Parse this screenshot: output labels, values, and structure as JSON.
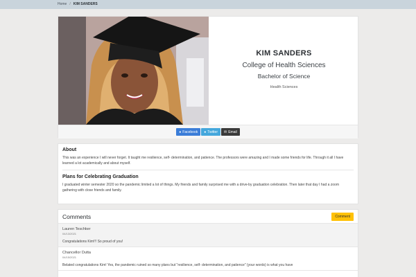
{
  "breadcrumb": {
    "home": "Home",
    "separator": "/",
    "current": "KIM SANDERS"
  },
  "profile": {
    "name": "KIM SANDERS",
    "college": "College of Health Sciences",
    "degree": "Bachelor of Science",
    "major": "Health Sciences"
  },
  "share": {
    "facebook": "Facebook",
    "twitter": "Twitter",
    "email": "Email"
  },
  "about": {
    "title": "About",
    "text": "This was an experience I will never forget. It taught me resilience, self- determination, and patience. The professors were amazing and I made some friends for life. Through it all I have learned a lot academically and about myself.",
    "plans_title": "Plans for Celebrating Graduation",
    "plans_text": "I graduated winter semester 2020 so the pandemic limited a lot of things. My friends and family surprised me with a drive-by graduation celebration. Then later that day I had a zoom gathering with close friends and family."
  },
  "comments": {
    "title": "Comments",
    "button": "Comment",
    "items": [
      {
        "name": "Lauren Teschker",
        "date": "04/13/2021",
        "text": "Congratulations Kim!!! So proud of you!"
      },
      {
        "name": "Chancellor Dutta",
        "date": "04/15/2021",
        "text": "Belated congratulations Kim! Yes, the pandemic ruined so many plans but \"resilience, self- determination, and patience\" (your words) is what you have"
      }
    ]
  },
  "colors": {
    "facebook": "#3b7dd8",
    "twitter": "#44a7dc",
    "email": "#3a3a3a",
    "comment_button": "#ffc107"
  }
}
